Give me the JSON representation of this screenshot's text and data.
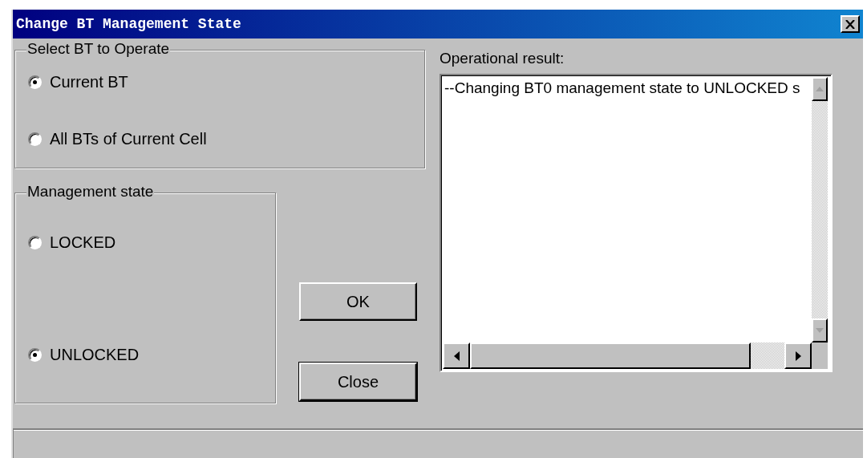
{
  "window": {
    "title": "Change BT Management State"
  },
  "bt_group": {
    "title": "Select BT to Operate",
    "options": [
      {
        "label": "Current BT",
        "selected": true
      },
      {
        "label": "All BTs of Current Cell",
        "selected": false
      }
    ]
  },
  "state_group": {
    "title": "Management state",
    "options": [
      {
        "label": "LOCKED",
        "selected": false
      },
      {
        "label": "UNLOCKED",
        "selected": true
      }
    ]
  },
  "buttons": [
    {
      "label": "OK"
    },
    {
      "label": "Close"
    }
  ],
  "result": {
    "label": "Operational result:",
    "text": "--Changing BT0 management state to UNLOCKED s"
  }
}
